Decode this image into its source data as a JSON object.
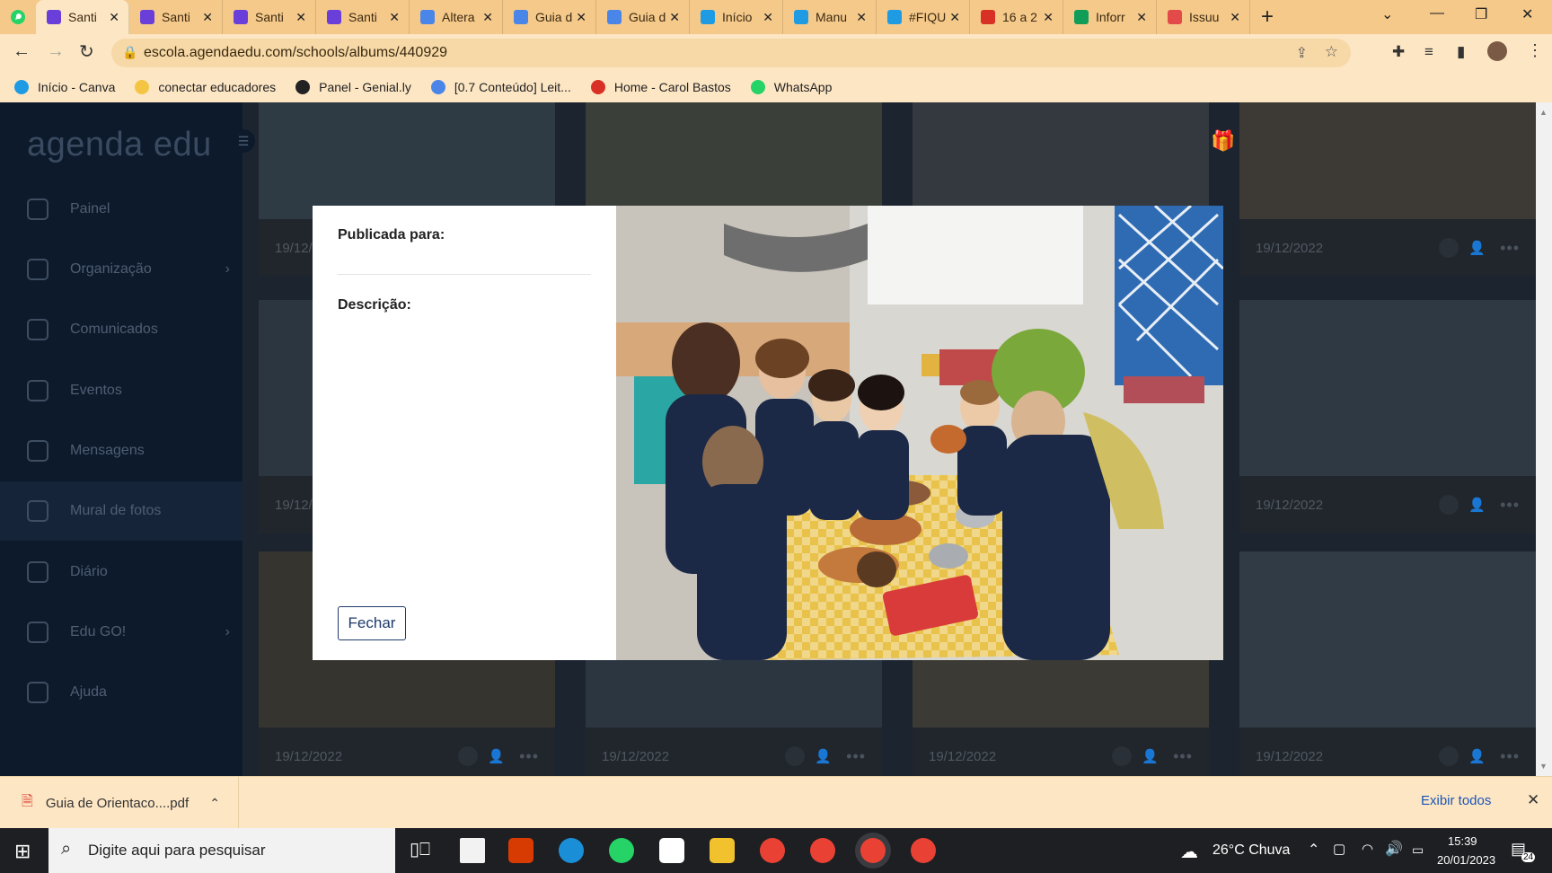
{
  "browser": {
    "tabs": [
      {
        "title": "Santi",
        "color": "#6a3fd9",
        "active": true
      },
      {
        "title": "Santi",
        "color": "#6a3fd9",
        "active": false
      },
      {
        "title": "Santi",
        "color": "#6a3fd9",
        "active": false
      },
      {
        "title": "Santi",
        "color": "#6a3fd9",
        "active": false
      },
      {
        "title": "Altera",
        "color": "#4a86e8",
        "active": false
      },
      {
        "title": "Guia d",
        "color": "#4a86e8",
        "active": false
      },
      {
        "title": "Guia d",
        "color": "#4a86e8",
        "active": false
      },
      {
        "title": "Início",
        "color": "#1e9be3",
        "active": false
      },
      {
        "title": "Manu",
        "color": "#1e9be3",
        "active": false
      },
      {
        "title": "#FIQU",
        "color": "#1e9be3",
        "active": false
      },
      {
        "title": "16 a 2",
        "color": "#d93025",
        "active": false
      },
      {
        "title": "Inforr",
        "color": "#0f9d58",
        "active": false
      },
      {
        "title": "Issuu",
        "color": "#e34a4a",
        "active": false
      }
    ],
    "new_tab_label": "+",
    "url": "escola.agendaedu.com/schools/albums/440929",
    "bookmarks": [
      {
        "label": "Início - Canva",
        "color": "#1e9be3"
      },
      {
        "label": "conectar educadores",
        "color": "#f4c542"
      },
      {
        "label": "Panel - Genial.ly",
        "color": "#222222"
      },
      {
        "label": "[0.7 Conteúdo] Leit...",
        "color": "#4a86e8"
      },
      {
        "label": "Home - Carol Bastos",
        "color": "#d93025"
      },
      {
        "label": "WhatsApp",
        "color": "#25d366"
      }
    ]
  },
  "app": {
    "logo": "agenda edu",
    "nav": [
      {
        "label": "Painel",
        "icon": "gauge-icon",
        "chevron": false,
        "active": false
      },
      {
        "label": "Organização",
        "icon": "org-chart-icon",
        "chevron": true,
        "active": false
      },
      {
        "label": "Comunicados",
        "icon": "megaphone-icon",
        "chevron": false,
        "active": false
      },
      {
        "label": "Eventos",
        "icon": "calendar-icon",
        "chevron": false,
        "active": false
      },
      {
        "label": "Mensagens",
        "icon": "chat-icon",
        "chevron": false,
        "active": false
      },
      {
        "label": "Mural de fotos",
        "icon": "camera-icon",
        "chevron": false,
        "active": true
      },
      {
        "label": "Diário",
        "icon": "diary-icon",
        "chevron": false,
        "active": false
      },
      {
        "label": "Edu GO!",
        "icon": "rocket-icon",
        "chevron": true,
        "active": false
      },
      {
        "label": "Ajuda",
        "icon": "help-icon",
        "chevron": false,
        "active": false
      }
    ],
    "photo_date": "19/12/2022"
  },
  "modal": {
    "published_for_label": "Publicada para:",
    "description_label": "Descrição:",
    "close_label": "Fechar"
  },
  "downloads": {
    "file": "Guia de Orientaco....pdf",
    "show_all": "Exibir todos"
  },
  "taskbar": {
    "search_placeholder": "Digite aqui para pesquisar",
    "weather": "26°C  Chuva",
    "time": "15:39",
    "date": "20/01/2023",
    "notifications": "24"
  }
}
